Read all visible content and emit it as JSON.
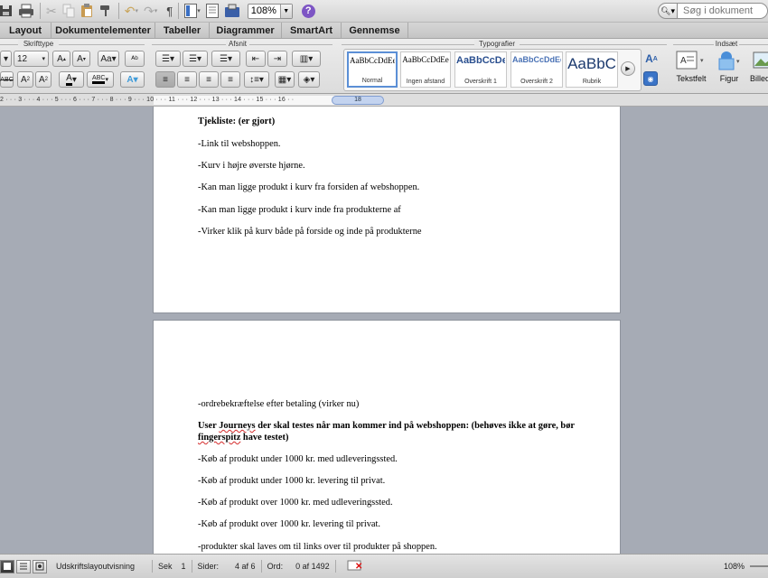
{
  "toolbar": {
    "zoom": "108%",
    "search_placeholder": "Søg i dokument",
    "icons": [
      "save-icon",
      "print-icon",
      "cut-icon",
      "copy-icon",
      "paste-icon",
      "format-painter-icon",
      "undo-icon",
      "redo-icon",
      "pilcrow-icon",
      "sidebar-icon",
      "gallery-icon",
      "toolbox-icon",
      "help-icon",
      "search-icon"
    ]
  },
  "tabs": [
    "Layout",
    "Dokumentelementer",
    "Tabeller",
    "Diagrammer",
    "SmartArt",
    "Gennemse"
  ],
  "ribbon": {
    "groups": {
      "font": "Skrifttype",
      "paragraph": "Afsnit",
      "styles": "Typografier",
      "insert": "Indsæt"
    },
    "font_size": "12",
    "styles": [
      {
        "sample": "AaBbCcDdEe",
        "name": "Normal",
        "selected": true
      },
      {
        "sample": "AaBbCcDdEe",
        "name": "Ingen afstand",
        "selected": false
      },
      {
        "sample": "AaBbCcDe",
        "name": "Overskrift 1",
        "selected": false
      },
      {
        "sample": "AaBbCcDdEe",
        "name": "Overskrift 2",
        "selected": false
      },
      {
        "sample": "AaBbC",
        "name": "Rubrik",
        "selected": false
      }
    ],
    "insert": [
      "Tekstfelt",
      "Figur",
      "Billeder"
    ]
  },
  "ruler": {
    "numbers": "2 · · · 3 · · · 4 · · · 5 · · · 6 · · · 7 · · · 8 · · · 9 · · · 10 · · · 11 · · · 12 · · · 13 · · · 14 · · · 15 · · · 16 · · ",
    "marker": "18"
  },
  "page1": {
    "heading": "Tjekliste: (er gjort)",
    "lines": [
      "-Link til webshoppen.",
      "-Kurv i højre øverste hjørne.",
      "-Kan man ligge produkt  i kurv fra forsiden af webshoppen.",
      "-Kan man ligge produkt i kurv inde fra produkterne af",
      "-Virker klik på kurv både på forside og inde på produkterne"
    ]
  },
  "page2": {
    "line1": "-ordrebekræftelse efter betaling (virker nu)",
    "heading_part1": "User ",
    "heading_journeys": "Journeys",
    "heading_part2": " der skal testes når man kommer ind på webshoppen: (behøves ikke at gøre, bør ",
    "heading_fingerspitz": "fingerspitz",
    "heading_part3": " have testet)",
    "lines": [
      "-Køb af produkt under 1000 kr. med udleveringssted.",
      "-Køb af produkt under 1000 kr. levering til privat.",
      "-Køb af produkt over 1000 kr. med udleveringssted.",
      "-Køb af produkt over 1000 kr. levering til privat.",
      "-produkter skal laves om til links over til produkter på shoppen."
    ]
  },
  "status": {
    "view": "Udskriftslayoutvisning",
    "sek_label": "Sek",
    "sek_value": "1",
    "pages_label": "Sider:",
    "pages_value": "4 af 6",
    "words_label": "Ord:",
    "words_value": "0 af 1492",
    "zoom": "108%"
  }
}
